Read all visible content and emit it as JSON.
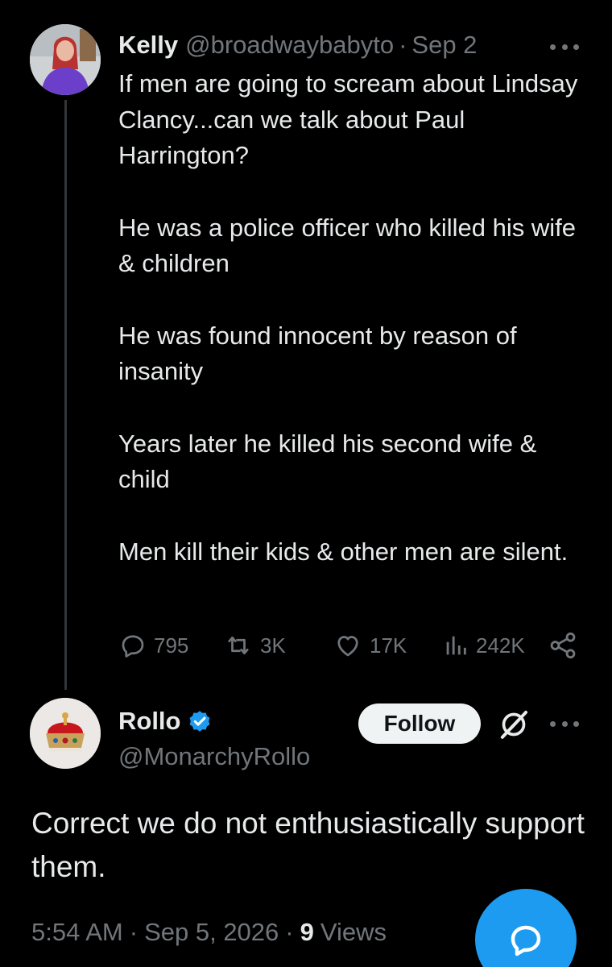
{
  "parent_tweet": {
    "author_name": "Kelly",
    "author_handle": "@broadwaybabyto",
    "separator": "·",
    "date": "Sep 2",
    "paragraphs": [
      "If men are going to scream about Lindsay Clancy...can we talk about Paul Harrington?",
      "He was a police officer who killed his wife & children",
      "He was found innocent by reason of insanity",
      "Years later he killed his second wife & child",
      "Men kill their kids & other men are silent."
    ],
    "stats": {
      "replies": "795",
      "reposts": "3K",
      "likes": "17K",
      "views": "242K"
    }
  },
  "reply_tweet": {
    "author_name": "Rollo",
    "author_handle": "@MonarchyRollo",
    "verified": true,
    "follow_label": "Follow",
    "text": "Correct we do not enthusiastically support them.",
    "time": "5:54 AM",
    "separator": "·",
    "date": "Sep 5, 2026",
    "views_count": "9",
    "views_label": "Views"
  },
  "icons": {
    "reply": "reply-icon",
    "retweet": "retweet-icon",
    "like": "heart-icon",
    "views": "views-bar-icon",
    "share": "share-icon",
    "more": "more-dots-icon",
    "verified": "verified-badge-icon",
    "grok": "grok-icon",
    "compose": "compose-reply-icon"
  },
  "colors": {
    "background": "#000000",
    "text": "#e7e9ea",
    "muted": "#71767b",
    "accent": "#1d9bf0",
    "thread_line": "#333639"
  }
}
